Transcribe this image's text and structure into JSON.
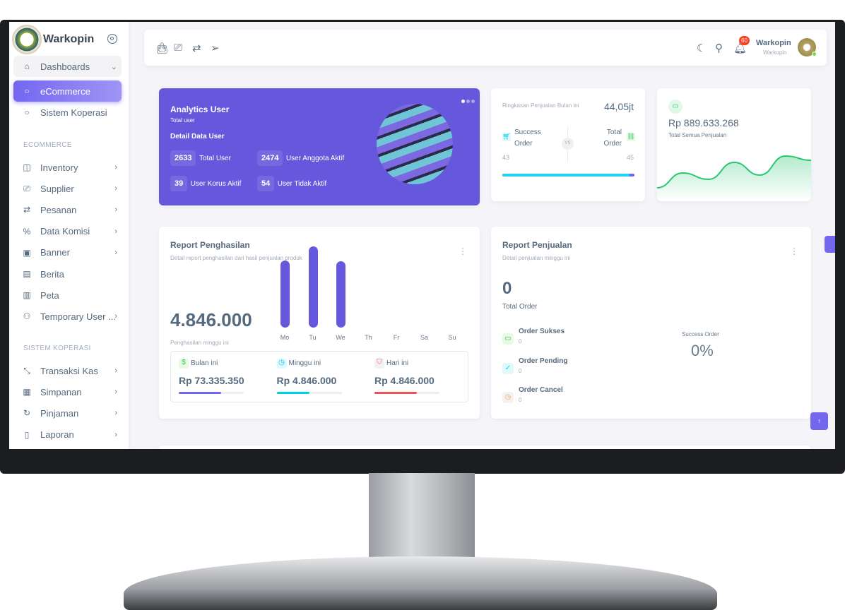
{
  "sidebar": {
    "brand": "Warkopin",
    "dashboards": {
      "label": "Dashboards",
      "children": [
        "eCommerce",
        "Sistem Koperasi"
      ]
    },
    "section_ecommerce": "ECOMMERCE",
    "ecommerce_items": [
      {
        "label": "Inventory",
        "icon": "shopping-bag-icon"
      },
      {
        "label": "Supplier",
        "icon": "cast-icon"
      },
      {
        "label": "Pesanan",
        "icon": "repeat-icon"
      },
      {
        "label": "Data Komisi",
        "icon": "percent-icon"
      },
      {
        "label": "Banner",
        "icon": "image-icon"
      },
      {
        "label": "Berita",
        "icon": "file-text-icon"
      },
      {
        "label": "Peta",
        "icon": "map-icon"
      },
      {
        "label": "Temporary User ...",
        "icon": "user-icon"
      }
    ],
    "section_koperasi": "SISTEM KOPERASI",
    "koperasi_items": [
      {
        "label": "Transaksi Kas",
        "icon": "minimize-icon"
      },
      {
        "label": "Simpanan",
        "icon": "save-icon"
      },
      {
        "label": "Pinjaman",
        "icon": "refresh-icon"
      },
      {
        "label": "Laporan",
        "icon": "file-icon"
      }
    ]
  },
  "header": {
    "notification_count": "60",
    "user_name": "Warkopin",
    "user_role": "Warkopin"
  },
  "analytics": {
    "title": "Analytics User",
    "subtitle": "Total user",
    "detail_title": "Detail Data User",
    "stats": [
      {
        "value": "2633",
        "label": "Total User"
      },
      {
        "value": "2474",
        "label": "User Anggota Aktif"
      },
      {
        "value": "39",
        "label": "User Korus Aktif"
      },
      {
        "value": "54",
        "label": "User Tidak Aktif"
      }
    ]
  },
  "ringkasan": {
    "title": "Ringkasan Penjualan Bulan ini",
    "value": "44,05jt",
    "left_label": "Success",
    "left_label2": "Order",
    "right_label": "Total",
    "right_label2": "Order",
    "vs": "VS",
    "left_value": "43",
    "right_value": "45",
    "progress_fraction": 0.96
  },
  "total_sales": {
    "value": "Rp 889.633.268",
    "label": "Total Semua Penjualan",
    "color": "#28c76f"
  },
  "report_penghasilan": {
    "title": "Report Penghasilan",
    "subtitle": "Detail report penghasilan dari hasil penjualan produk",
    "value": "4.846.000",
    "value_label": "Penghasilan minggu ini",
    "summary": [
      {
        "label": "Bulan ini",
        "value": "Rp 73.335.350",
        "progress": 0.65,
        "color": "#7367f0"
      },
      {
        "label": "Minggu ini",
        "value": "Rp 4.846.000",
        "progress": 0.5,
        "color": "#00cfe8"
      },
      {
        "label": "Hari ini",
        "value": "Rp 4.846.000",
        "progress": 0.65,
        "color": "#ea5455"
      }
    ]
  },
  "report_penjualan": {
    "title": "Report Penjualan",
    "subtitle": "Detail penjualan minggu ini",
    "total": "0",
    "total_label": "Total Order",
    "orders": [
      {
        "label": "Order Sukses",
        "value": "0"
      },
      {
        "label": "Order Pending",
        "value": "0"
      },
      {
        "label": "Order Cancel",
        "value": "0"
      }
    ],
    "success_label": "Success Order",
    "success_value": "0%"
  },
  "chart_data": [
    {
      "type": "bar",
      "categories": [
        "Mo",
        "Tu",
        "We",
        "Th",
        "Fr",
        "Sa",
        "Su"
      ],
      "values": [
        0.83,
        1.0,
        0.82,
        0,
        0,
        0,
        0
      ],
      "color": "#6658dd"
    },
    {
      "type": "area",
      "values": [
        0.15,
        0.5,
        0.35,
        0.75,
        0.45,
        0.9,
        0.8
      ],
      "color": "#28c76f"
    }
  ]
}
